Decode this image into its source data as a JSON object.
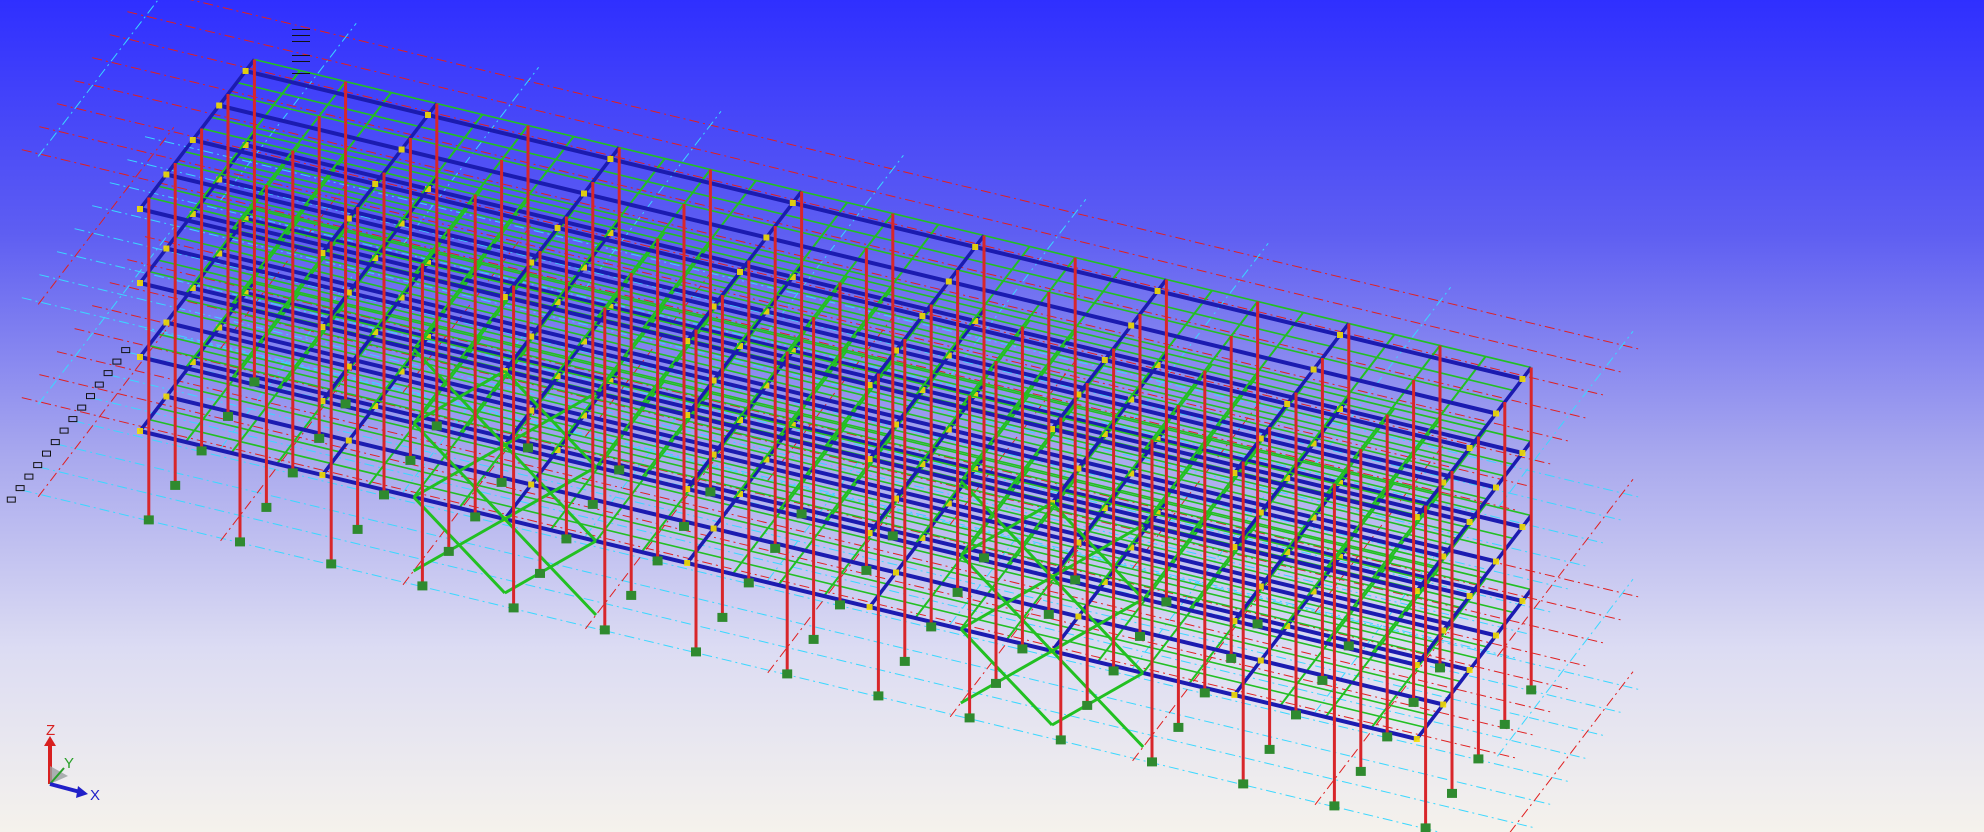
{
  "viewport": {
    "background_top": "#2f2fff",
    "background_bottom": "#f5f2ec"
  },
  "model": {
    "colors": {
      "columns": "#d8262a",
      "primary_beams": "#1b1bb0",
      "secondary_members": "#22c022",
      "grid_lines_cyan": "#3ad8ff",
      "grid_lines_red": "#e02020",
      "connections": "#f5e000",
      "footings": "#2f8a2f"
    }
  },
  "axis_triad": {
    "z_label": "Z",
    "y_label": "Y",
    "x_label": "X",
    "z_color": "#d82020",
    "y_color": "#2aa02a",
    "x_color": "#2020c8"
  }
}
